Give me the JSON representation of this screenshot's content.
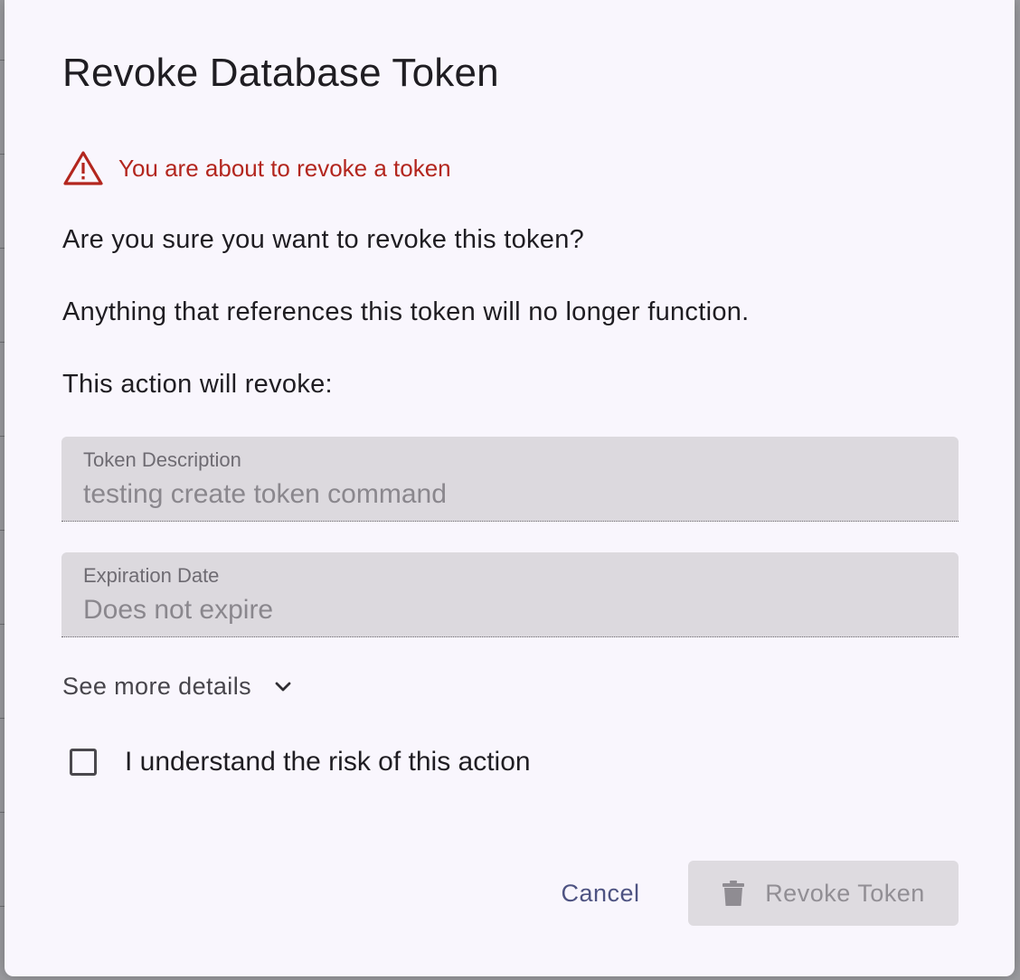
{
  "dialog": {
    "title": "Revoke Database Token",
    "warning": {
      "icon": "warning-triangle-icon",
      "text": "You are about to revoke a token",
      "color": "#b3261e"
    },
    "confirm_question": "Are you sure you want to revoke this token?",
    "consequence": "Anything that references this token will no longer function.",
    "revoke_intro": "This action will revoke:",
    "fields": [
      {
        "label": "Token Description",
        "value": "testing create token command"
      },
      {
        "label": "Expiration Date",
        "value": "Does not expire"
      }
    ],
    "see_more": {
      "label": "See more details",
      "icon": "chevron-down-icon"
    },
    "acknowledge": {
      "label": "I understand the risk of this action",
      "checked": false
    },
    "actions": {
      "cancel_label": "Cancel",
      "revoke_label": "Revoke Token",
      "revoke_icon": "trash-icon",
      "revoke_disabled": true
    }
  }
}
